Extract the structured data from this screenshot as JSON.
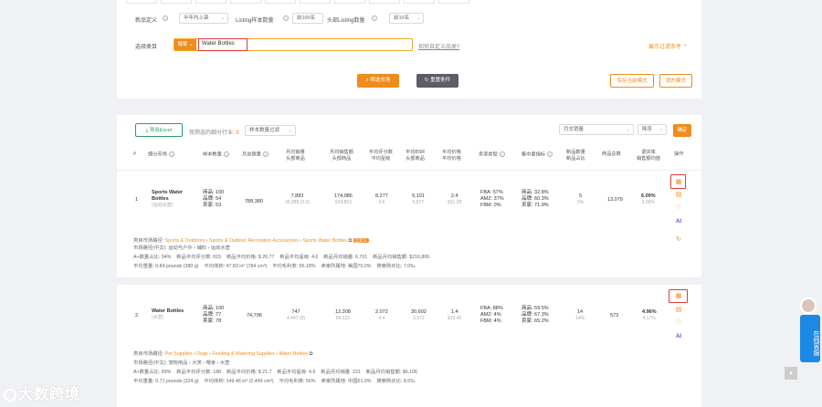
{
  "filters": {
    "new_definition_label": "新品定义",
    "new_definition_value": "半年内上架",
    "listing_sample_label": "Listing样本数量",
    "listing_sample_value": "前100名",
    "head_listing_label": "头部Listing数量",
    "head_listing_value": "前10名",
    "category_label": "选择类目",
    "search_type": "搜索",
    "search_value": "Water Bottles",
    "custom_category_link": "如何自定义品类?",
    "expand_link": "展示过滤条件",
    "search_market_button": "筛选市场",
    "reset_button": "重置条件",
    "save_template_button": "保存当前模式",
    "my_template_button": "我的模式"
  },
  "toolbar": {
    "export_button": "导出Excel",
    "industry_text": "我筛选的细分行业:",
    "industry_count": "8",
    "sample_filter": "样本数量过滤",
    "sort_field": "月总销量",
    "sort_order": "降序",
    "confirm_button": "确定"
  },
  "columns": [
    "#",
    "细分市场",
    "样本数量",
    "月总销量",
    "月均销量\n头部商品",
    "月均销售额\n头部商品",
    "平均评分数\n平均星级",
    "平均BSR\n头部商品",
    "平均价格\n平均价格",
    "卖家类型",
    "集中度指标",
    "新品数量\n新品占比",
    "商品总数",
    "退货率\n销售额均值",
    "操作"
  ],
  "rows": [
    {
      "index": "1",
      "name": "Sports Water Bottles",
      "name_cn": "(运动水壶)",
      "sample_products": "商品: 100",
      "sample_brands": "品牌: 54",
      "sample_sellers": "卖家: 53",
      "monthly_sales": "788,380",
      "avg_sales": "7,883",
      "avg_sales_sub": "35,889 (3.3)",
      "avg_revenue": "174,986",
      "avg_revenue_sub": "634,853",
      "avg_reviews": "8,277",
      "avg_rating": "4.6",
      "avg_bsr": "9,101",
      "avg_bsr_sub": "6,877",
      "avg_price": "2.4",
      "avg_price_sub": "$31.28",
      "seller_fba": "FBA: 57%",
      "seller_amz": "AMZ: 37%",
      "seller_fbm": "FBM: 0%",
      "conc_products": "商品: 32.8%",
      "conc_brands": "品牌: 60.3%",
      "conc_sellers": "卖家: 71.9%",
      "new_count": "5",
      "new_ratio": "5%",
      "total_products": "13,079",
      "return_rate": "6.09%",
      "return_sub": "9.00%",
      "path_label": "类目市场路径:",
      "path": [
        "Sports & Outdoors",
        "Sports & Outdoor Recreation Accessories",
        "Sports Water Bottles"
      ],
      "path_badge": "自定义",
      "path_cn": "市场路径(中文): 运动与户外 › 辅料 › 运动水壶",
      "stats_line1": "A+数量占比: 94%    新品平均评分数: 815    新品平均价格: $ 26.77    新品平均星级: 4.6    新品月均销量: 6,701    新品月均销售额: $216,806",
      "stats_line2": "平均重量: 0.84 pounds (380 g)    平均体积: 47.83 in³ (784 cm³)    平均毛利率: 56.18%    卖家所属地: 美国70.0%    搜索购买比: 7.0‰"
    },
    {
      "index": "2",
      "name": "Water Bottles",
      "name_cn": "(水壶)",
      "sample_products": "商品: 100",
      "sample_brands": "品牌: 77",
      "sample_sellers": "卖家: 78",
      "monthly_sales": "74,796",
      "avg_sales": "747",
      "avg_sales_sub": "4,447 (6)",
      "avg_revenue": "12,308",
      "avg_revenue_sub": "69,132",
      "avg_reviews": "2,072",
      "avg_rating": "4.4",
      "avg_bsr": "30,602",
      "avg_bsr_sub": "3,972",
      "avg_price": "1.4",
      "avg_price_sub": "$19.45",
      "seller_fba": "FBA: 88%",
      "seller_amz": "AMZ: 4%",
      "seller_fbm": "FBM: 4%",
      "conc_products": "商品: 59.5%",
      "conc_brands": "品牌: 67.3%",
      "conc_sellers": "卖家: 65.2%",
      "new_count": "14",
      "new_ratio": "14%",
      "total_products": "573",
      "return_rate": "4.96%",
      "return_sub": "4.17%",
      "path_label": "类目市场路径:",
      "path": [
        "Pet Supplies",
        "Dogs",
        "Feeding & Watering Supplies",
        "Water Bottles"
      ],
      "path_badge": "",
      "path_cn": "市场路径(中文): 宠物用品 › 犬类 › 喂食 › 水壶",
      "stats_line1": "A+数量占比: 89%    新品平均评分数: 188    新品平均价格: $ 21.7    新品平均星级: 4.6    新品月均销量: 221    新品月均销售额: $6,106",
      "stats_line2": "平均重量: 0.71 pounds (324 g)    平均体积: 149.46 in³ (2,449 cm³)    平均毛利率: 56%    卖家所属地: 中国61.0%    搜索购买比: 8.6‰"
    }
  ],
  "side_widget": "在线客服",
  "logo": "大数跨境",
  "colors": {
    "accent": "#f08c1c",
    "highlight": "#e53935",
    "chat": "#1e88e5"
  }
}
